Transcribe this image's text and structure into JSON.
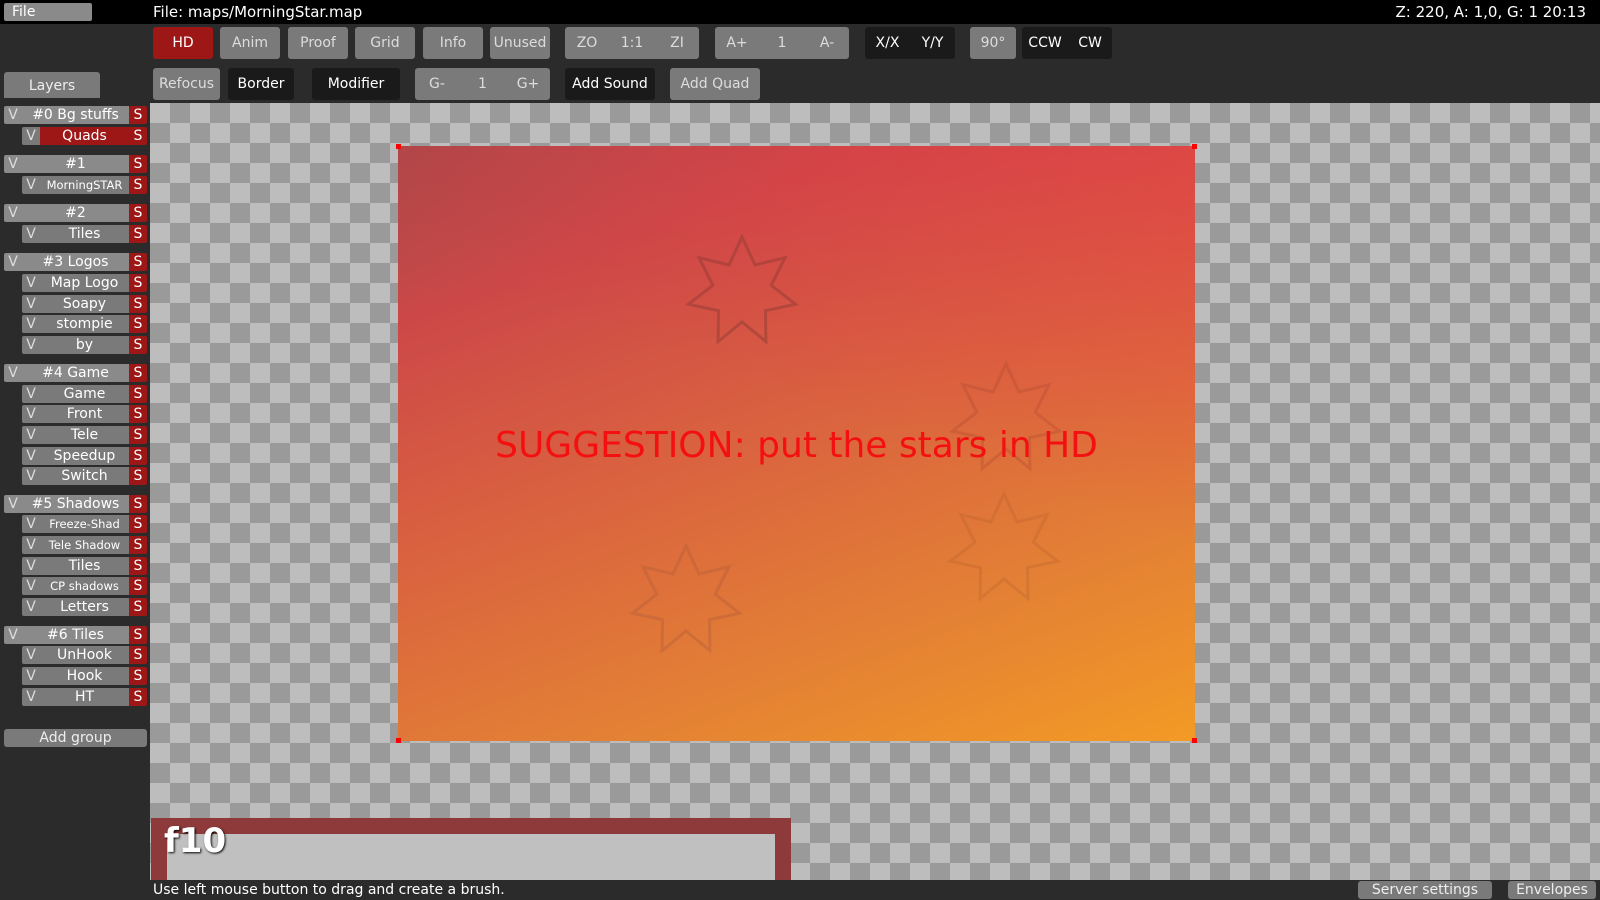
{
  "topbar": {
    "file_menu": "File",
    "file_title": "File: maps/MorningStar.map",
    "status": "Z: 220, A: 1,0, G: 1  20:13"
  },
  "toolbar": {
    "hd": "HD",
    "anim": "Anim",
    "proof": "Proof",
    "grid": "Grid",
    "info": "Info",
    "unused": "Unused",
    "zoom_out": "ZO",
    "zoom_reset": "1:1",
    "zoom_in": "ZI",
    "anim_faster": "A+",
    "anim_speed": "1",
    "anim_slower": "A-",
    "flip_x": "X/X",
    "flip_y": "Y/Y",
    "rotate_amount": "90°",
    "rotate_ccw": "CCW",
    "rotate_cw": "CW",
    "refocus": "Refocus",
    "border": "Border",
    "modifier": "Modifier",
    "grid_minus": "G-",
    "grid_factor": "1",
    "grid_plus": "G+",
    "add_sound": "Add Sound",
    "add_quad": "Add Quad"
  },
  "layers": {
    "tab_label": "Layers",
    "rows": [
      {
        "v": "V",
        "name": "#0 Bg stuffs",
        "s": "S"
      },
      {
        "v": "V",
        "name": "Quads",
        "s": "S"
      },
      {
        "v": "V",
        "name": "#1",
        "s": "S"
      },
      {
        "v": "V",
        "name": "MorningSTAR",
        "s": "S"
      },
      {
        "v": "V",
        "name": "#2",
        "s": "S"
      },
      {
        "v": "V",
        "name": "Tiles",
        "s": "S"
      },
      {
        "v": "V",
        "name": "#3 Logos",
        "s": "S"
      },
      {
        "v": "V",
        "name": "Map Logo",
        "s": "S"
      },
      {
        "v": "V",
        "name": "Soapy",
        "s": "S"
      },
      {
        "v": "V",
        "name": "stompie",
        "s": "S"
      },
      {
        "v": "V",
        "name": "by",
        "s": "S"
      },
      {
        "v": "V",
        "name": "#4 Game",
        "s": "S"
      },
      {
        "v": "V",
        "name": "Game",
        "s": "S"
      },
      {
        "v": "V",
        "name": "Front",
        "s": "S"
      },
      {
        "v": "V",
        "name": "Tele",
        "s": "S"
      },
      {
        "v": "V",
        "name": "Speedup",
        "s": "S"
      },
      {
        "v": "V",
        "name": "Switch",
        "s": "S"
      },
      {
        "v": "V",
        "name": "#5 Shadows",
        "s": "S"
      },
      {
        "v": "V",
        "name": "Freeze-Shad",
        "s": "S"
      },
      {
        "v": "V",
        "name": "Tele Shadow",
        "s": "S"
      },
      {
        "v": "V",
        "name": "Tiles",
        "s": "S"
      },
      {
        "v": "V",
        "name": "CP shadows",
        "s": "S"
      },
      {
        "v": "V",
        "name": "Letters",
        "s": "S"
      },
      {
        "v": "V",
        "name": "#6 Tiles",
        "s": "S"
      },
      {
        "v": "V",
        "name": "UnHook",
        "s": "S"
      },
      {
        "v": "V",
        "name": "Hook",
        "s": "S"
      },
      {
        "v": "V",
        "name": "HT",
        "s": "S"
      }
    ],
    "add_group": "Add group"
  },
  "canvas": {
    "quad_text": "SUGGESTION: put the stars in HD",
    "brush_label": "f10"
  },
  "statusbar": {
    "hint": "Use left mouse button to drag and create a brush.",
    "server_settings": "Server settings",
    "envelopes": "Envelopes"
  },
  "colors": {
    "accent_red": "#9e1717",
    "button_gray": "#7a7a7a",
    "suggestion_text": "#f41010"
  }
}
